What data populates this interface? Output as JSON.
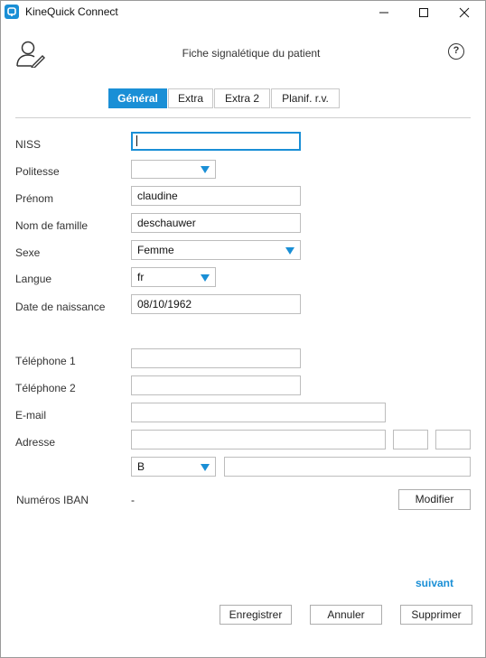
{
  "window": {
    "title": "KineQuick Connect"
  },
  "header": {
    "title": "Fiche signalétique du patient",
    "help_symbol": "?"
  },
  "tabs": [
    {
      "label": "Général",
      "active": true
    },
    {
      "label": "Extra",
      "active": false
    },
    {
      "label": "Extra 2",
      "active": false
    },
    {
      "label": "Planif. r.v.",
      "active": false
    }
  ],
  "form": {
    "niss": {
      "label": "NISS",
      "value": ""
    },
    "politesse": {
      "label": "Politesse",
      "value": ""
    },
    "prenom": {
      "label": "Prénom",
      "value": "claudine"
    },
    "nom": {
      "label": "Nom de famille",
      "value": "deschauwer"
    },
    "sexe": {
      "label": "Sexe",
      "value": "Femme"
    },
    "langue": {
      "label": "Langue",
      "value": "fr"
    },
    "naissance": {
      "label": "Date de naissance",
      "value": "08/10/1962"
    },
    "tel1": {
      "label": "Téléphone 1",
      "value": ""
    },
    "tel2": {
      "label": "Téléphone 2",
      "value": ""
    },
    "email": {
      "label": "E-mail",
      "value": ""
    },
    "adresse": {
      "label": "Adresse",
      "street": "",
      "number": "",
      "box": ""
    },
    "pays": {
      "value": "B"
    },
    "localite": {
      "value": ""
    },
    "iban": {
      "label": "Numéros IBAN",
      "value": "-",
      "button": "Modifier"
    }
  },
  "nav": {
    "next": "suivant"
  },
  "footer": {
    "save": "Enregistrer",
    "cancel": "Annuler",
    "delete": "Supprimer"
  },
  "colors": {
    "accent": "#1a8fd6",
    "border": "#bdbdbd"
  },
  "icons": {
    "app": "app-logo-icon",
    "header": "user-edit-icon",
    "help": "help-icon",
    "dropdown": "chevron-down-icon"
  }
}
